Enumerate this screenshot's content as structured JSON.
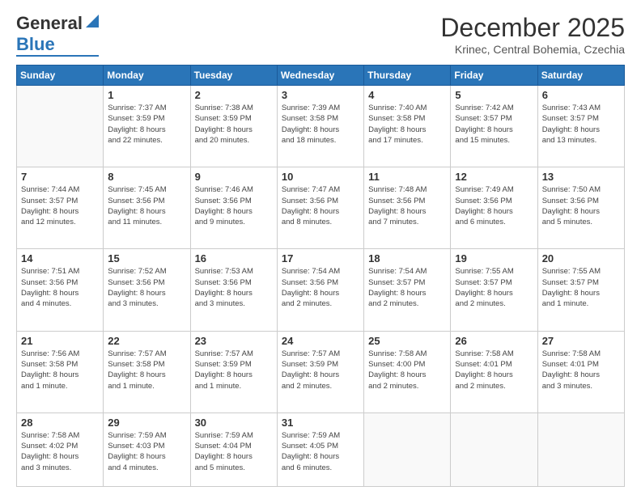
{
  "header": {
    "logo_line1": "General",
    "logo_line2": "Blue",
    "month": "December 2025",
    "location": "Krinec, Central Bohemia, Czechia"
  },
  "weekdays": [
    "Sunday",
    "Monday",
    "Tuesday",
    "Wednesday",
    "Thursday",
    "Friday",
    "Saturday"
  ],
  "weeks": [
    [
      {
        "day": "",
        "info": ""
      },
      {
        "day": "1",
        "info": "Sunrise: 7:37 AM\nSunset: 3:59 PM\nDaylight: 8 hours\nand 22 minutes."
      },
      {
        "day": "2",
        "info": "Sunrise: 7:38 AM\nSunset: 3:59 PM\nDaylight: 8 hours\nand 20 minutes."
      },
      {
        "day": "3",
        "info": "Sunrise: 7:39 AM\nSunset: 3:58 PM\nDaylight: 8 hours\nand 18 minutes."
      },
      {
        "day": "4",
        "info": "Sunrise: 7:40 AM\nSunset: 3:58 PM\nDaylight: 8 hours\nand 17 minutes."
      },
      {
        "day": "5",
        "info": "Sunrise: 7:42 AM\nSunset: 3:57 PM\nDaylight: 8 hours\nand 15 minutes."
      },
      {
        "day": "6",
        "info": "Sunrise: 7:43 AM\nSunset: 3:57 PM\nDaylight: 8 hours\nand 13 minutes."
      }
    ],
    [
      {
        "day": "7",
        "info": "Sunrise: 7:44 AM\nSunset: 3:57 PM\nDaylight: 8 hours\nand 12 minutes."
      },
      {
        "day": "8",
        "info": "Sunrise: 7:45 AM\nSunset: 3:56 PM\nDaylight: 8 hours\nand 11 minutes."
      },
      {
        "day": "9",
        "info": "Sunrise: 7:46 AM\nSunset: 3:56 PM\nDaylight: 8 hours\nand 9 minutes."
      },
      {
        "day": "10",
        "info": "Sunrise: 7:47 AM\nSunset: 3:56 PM\nDaylight: 8 hours\nand 8 minutes."
      },
      {
        "day": "11",
        "info": "Sunrise: 7:48 AM\nSunset: 3:56 PM\nDaylight: 8 hours\nand 7 minutes."
      },
      {
        "day": "12",
        "info": "Sunrise: 7:49 AM\nSunset: 3:56 PM\nDaylight: 8 hours\nand 6 minutes."
      },
      {
        "day": "13",
        "info": "Sunrise: 7:50 AM\nSunset: 3:56 PM\nDaylight: 8 hours\nand 5 minutes."
      }
    ],
    [
      {
        "day": "14",
        "info": "Sunrise: 7:51 AM\nSunset: 3:56 PM\nDaylight: 8 hours\nand 4 minutes."
      },
      {
        "day": "15",
        "info": "Sunrise: 7:52 AM\nSunset: 3:56 PM\nDaylight: 8 hours\nand 3 minutes."
      },
      {
        "day": "16",
        "info": "Sunrise: 7:53 AM\nSunset: 3:56 PM\nDaylight: 8 hours\nand 3 minutes."
      },
      {
        "day": "17",
        "info": "Sunrise: 7:54 AM\nSunset: 3:56 PM\nDaylight: 8 hours\nand 2 minutes."
      },
      {
        "day": "18",
        "info": "Sunrise: 7:54 AM\nSunset: 3:57 PM\nDaylight: 8 hours\nand 2 minutes."
      },
      {
        "day": "19",
        "info": "Sunrise: 7:55 AM\nSunset: 3:57 PM\nDaylight: 8 hours\nand 2 minutes."
      },
      {
        "day": "20",
        "info": "Sunrise: 7:55 AM\nSunset: 3:57 PM\nDaylight: 8 hours\nand 1 minute."
      }
    ],
    [
      {
        "day": "21",
        "info": "Sunrise: 7:56 AM\nSunset: 3:58 PM\nDaylight: 8 hours\nand 1 minute."
      },
      {
        "day": "22",
        "info": "Sunrise: 7:57 AM\nSunset: 3:58 PM\nDaylight: 8 hours\nand 1 minute."
      },
      {
        "day": "23",
        "info": "Sunrise: 7:57 AM\nSunset: 3:59 PM\nDaylight: 8 hours\nand 1 minute."
      },
      {
        "day": "24",
        "info": "Sunrise: 7:57 AM\nSunset: 3:59 PM\nDaylight: 8 hours\nand 2 minutes."
      },
      {
        "day": "25",
        "info": "Sunrise: 7:58 AM\nSunset: 4:00 PM\nDaylight: 8 hours\nand 2 minutes."
      },
      {
        "day": "26",
        "info": "Sunrise: 7:58 AM\nSunset: 4:01 PM\nDaylight: 8 hours\nand 2 minutes."
      },
      {
        "day": "27",
        "info": "Sunrise: 7:58 AM\nSunset: 4:01 PM\nDaylight: 8 hours\nand 3 minutes."
      }
    ],
    [
      {
        "day": "28",
        "info": "Sunrise: 7:58 AM\nSunset: 4:02 PM\nDaylight: 8 hours\nand 3 minutes."
      },
      {
        "day": "29",
        "info": "Sunrise: 7:59 AM\nSunset: 4:03 PM\nDaylight: 8 hours\nand 4 minutes."
      },
      {
        "day": "30",
        "info": "Sunrise: 7:59 AM\nSunset: 4:04 PM\nDaylight: 8 hours\nand 5 minutes."
      },
      {
        "day": "31",
        "info": "Sunrise: 7:59 AM\nSunset: 4:05 PM\nDaylight: 8 hours\nand 6 minutes."
      },
      {
        "day": "",
        "info": ""
      },
      {
        "day": "",
        "info": ""
      },
      {
        "day": "",
        "info": ""
      }
    ]
  ]
}
